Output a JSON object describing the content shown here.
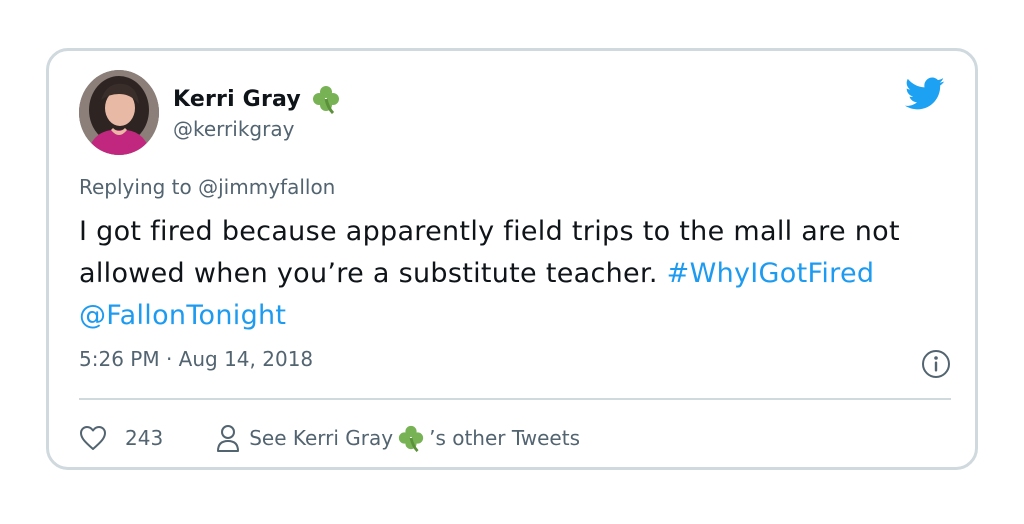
{
  "user": {
    "display_name": "Kerri Gray",
    "emoji": "shamrock",
    "handle": "@kerrikgray",
    "avatar": "profile-photo"
  },
  "reply": {
    "prefix": "Replying to",
    "mention": "@jimmyfallon"
  },
  "tweet": {
    "text": "I got fired because apparently field trips to the mall are not allowed when you’re a substitute teacher.",
    "hashtag": "#WhyIGotFired",
    "mention": "@FallonTonight"
  },
  "meta": {
    "time": "5:26 PM",
    "separator": "·",
    "date": "Aug 14, 2018"
  },
  "actions": {
    "like_count": "243",
    "see_prefix": "See Kerri Gray",
    "see_suffix": "’s other Tweets"
  },
  "icons": {
    "brand": "twitter-bird-icon",
    "info": "info-icon",
    "like": "heart-icon",
    "profile": "person-icon"
  },
  "colors": {
    "link": "#1d9bf0",
    "brand_blue": "#1da1f2",
    "text": "#0f1419",
    "muted": "#536471",
    "border": "#cfd9de",
    "shamrock": "#77b255"
  }
}
